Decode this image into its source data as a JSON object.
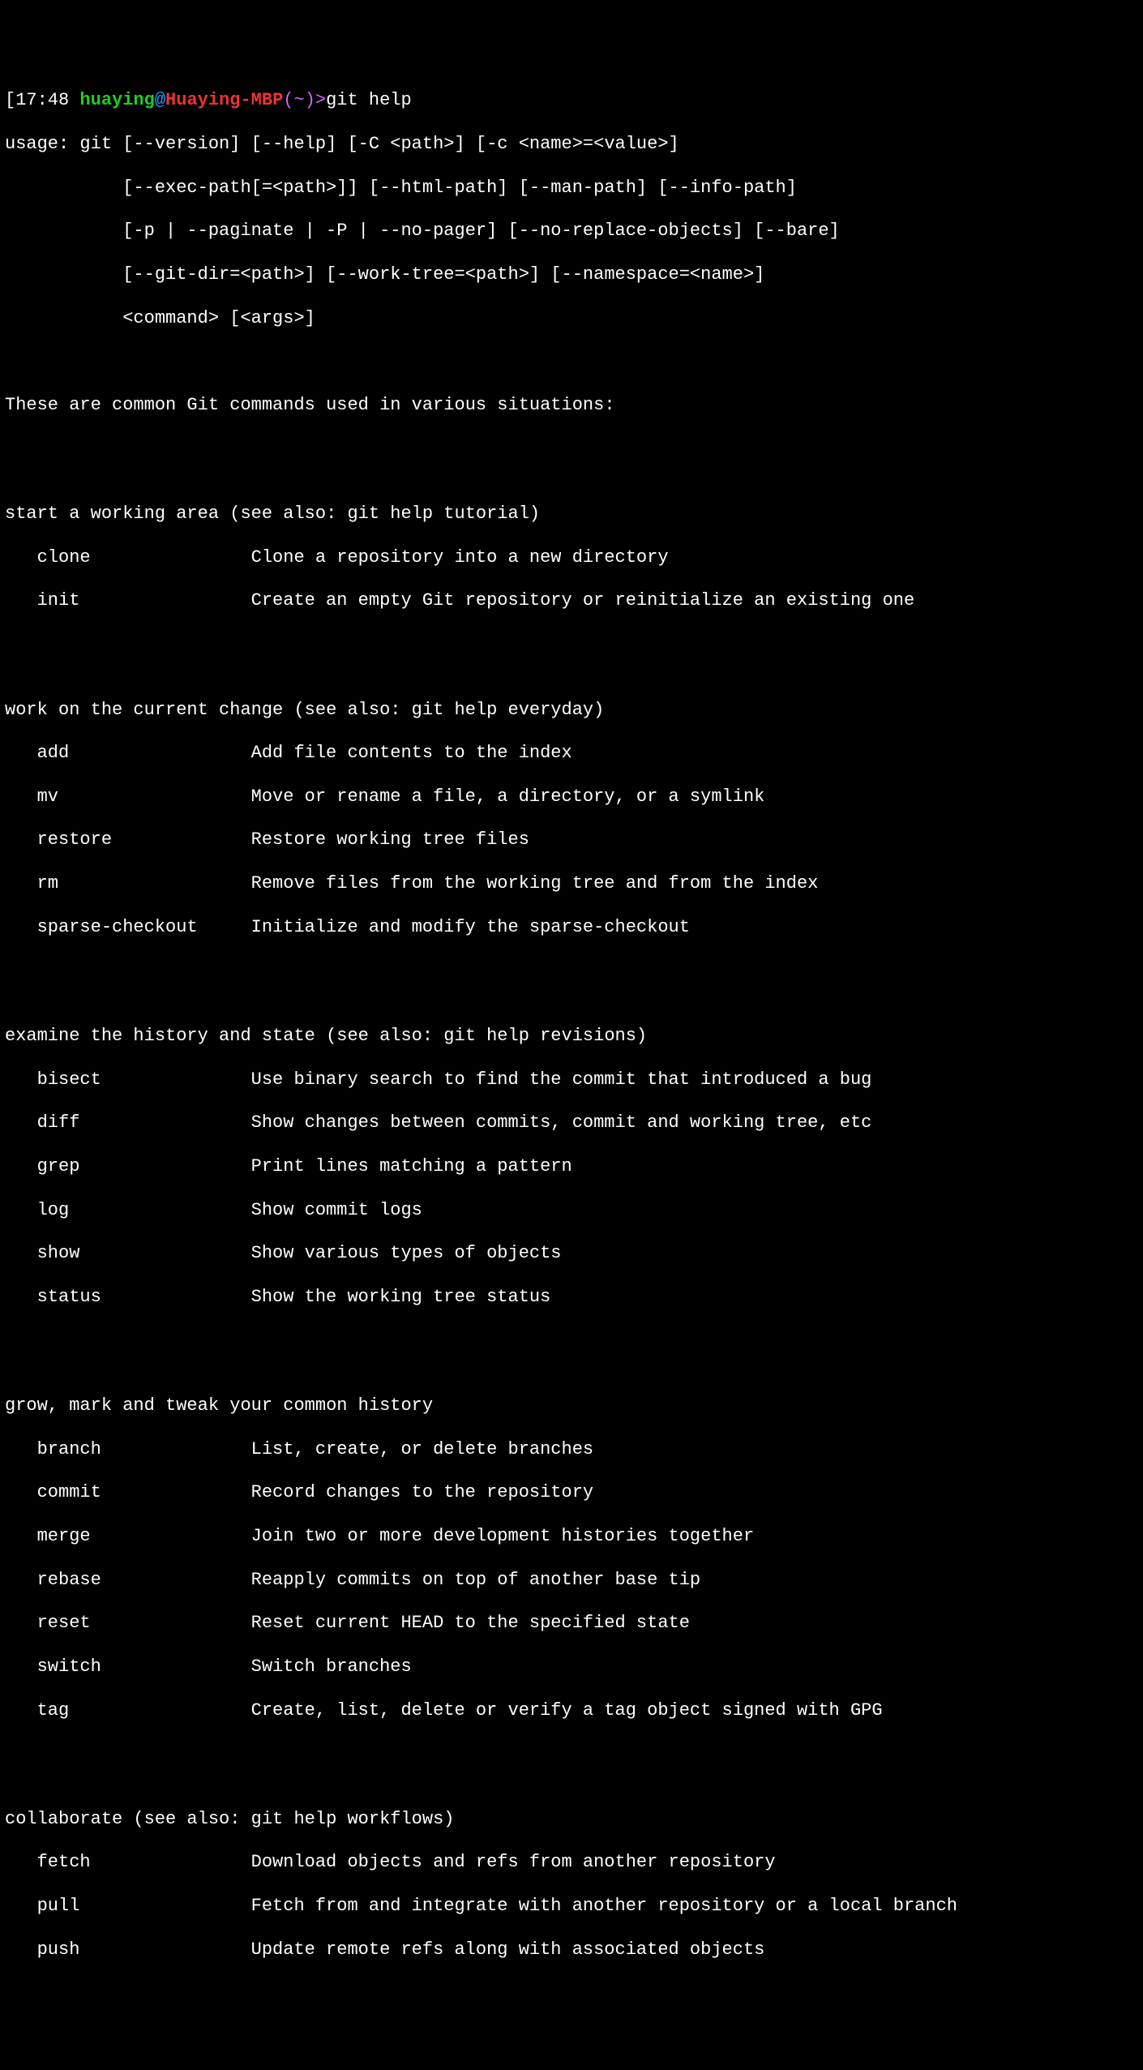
{
  "prompt": {
    "time_open": "[",
    "time": "17:48",
    "user": "huaying",
    "at": "@",
    "host": "Huaying-MBP",
    "path_open": "(",
    "path": "~",
    "path_close": ")",
    "arrow": ">",
    "command": "git help"
  },
  "usage": {
    "line0": "usage: git [--version] [--help] [-C <path>] [-c <name>=<value>]",
    "line1": "[--exec-path[=<path>]] [--html-path] [--man-path] [--info-path]",
    "line2": "[-p | --paginate | -P | --no-pager] [--no-replace-objects] [--bare]",
    "line3": "[--git-dir=<path>] [--work-tree=<path>] [--namespace=<name>]",
    "line4": "<command> [<args>]"
  },
  "intro": "These are common Git commands used in various situations:",
  "sections": {
    "s0": {
      "title": "start a working area (see also: git help tutorial)",
      "items": {
        "i0": {
          "name": "clone",
          "desc": "Clone a repository into a new directory"
        },
        "i1": {
          "name": "init",
          "desc": "Create an empty Git repository or reinitialize an existing one"
        }
      }
    },
    "s1": {
      "title": "work on the current change (see also: git help everyday)",
      "items": {
        "i0": {
          "name": "add",
          "desc": "Add file contents to the index"
        },
        "i1": {
          "name": "mv",
          "desc": "Move or rename a file, a directory, or a symlink"
        },
        "i2": {
          "name": "restore",
          "desc": "Restore working tree files"
        },
        "i3": {
          "name": "rm",
          "desc": "Remove files from the working tree and from the index"
        },
        "i4": {
          "name": "sparse-checkout",
          "desc": "Initialize and modify the sparse-checkout"
        }
      }
    },
    "s2": {
      "title": "examine the history and state (see also: git help revisions)",
      "items": {
        "i0": {
          "name": "bisect",
          "desc": "Use binary search to find the commit that introduced a bug"
        },
        "i1": {
          "name": "diff",
          "desc": "Show changes between commits, commit and working tree, etc"
        },
        "i2": {
          "name": "grep",
          "desc": "Print lines matching a pattern"
        },
        "i3": {
          "name": "log",
          "desc": "Show commit logs"
        },
        "i4": {
          "name": "show",
          "desc": "Show various types of objects"
        },
        "i5": {
          "name": "status",
          "desc": "Show the working tree status"
        }
      }
    },
    "s3": {
      "title": "grow, mark and tweak your common history",
      "items": {
        "i0": {
          "name": "branch",
          "desc": "List, create, or delete branches"
        },
        "i1": {
          "name": "commit",
          "desc": "Record changes to the repository"
        },
        "i2": {
          "name": "merge",
          "desc": "Join two or more development histories together"
        },
        "i3": {
          "name": "rebase",
          "desc": "Reapply commits on top of another base tip"
        },
        "i4": {
          "name": "reset",
          "desc": "Reset current HEAD to the specified state"
        },
        "i5": {
          "name": "switch",
          "desc": "Switch branches"
        },
        "i6": {
          "name": "tag",
          "desc": "Create, list, delete or verify a tag object signed with GPG"
        }
      }
    },
    "s4": {
      "title": "collaborate (see also: git help workflows)",
      "items": {
        "i0": {
          "name": "fetch",
          "desc": "Download objects and refs from another repository"
        },
        "i1": {
          "name": "pull",
          "desc": "Fetch from and integrate with another repository or a local branch"
        },
        "i2": {
          "name": "push",
          "desc": "Update remote refs along with associated objects"
        }
      }
    }
  }
}
